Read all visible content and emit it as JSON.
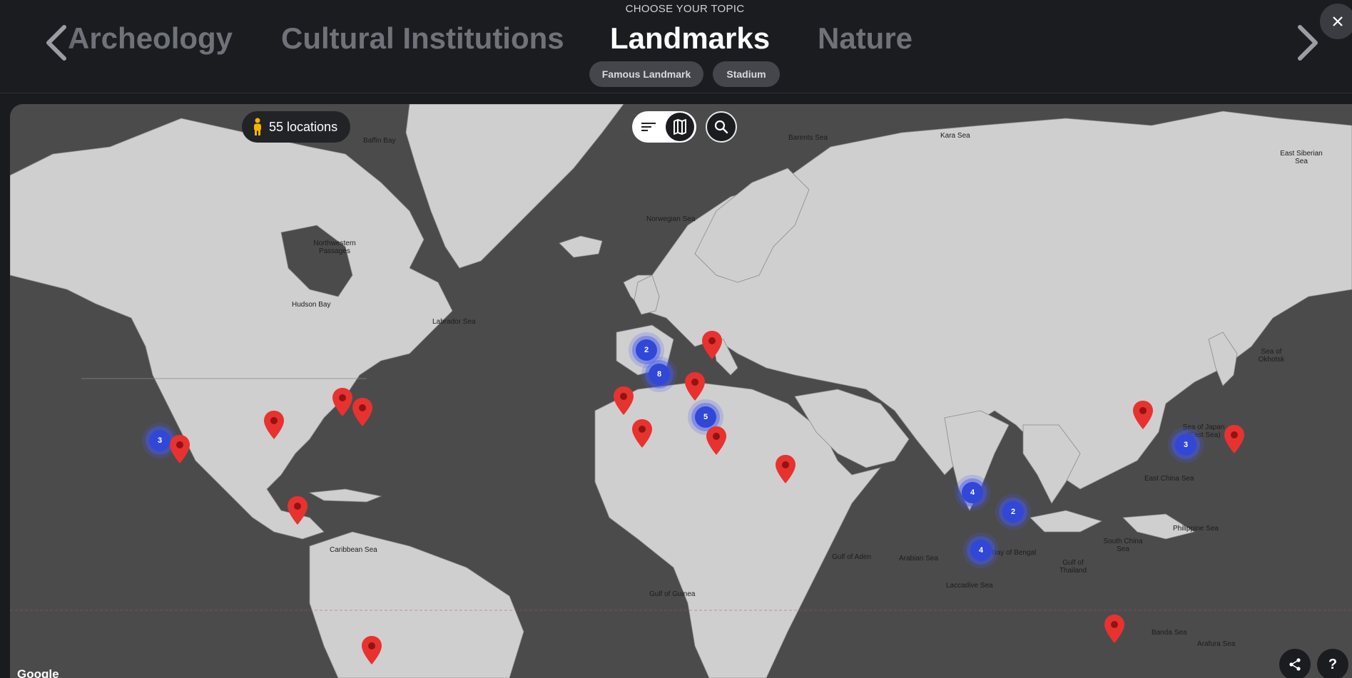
{
  "header": {
    "subtitle": "CHOOSE YOUR TOPIC",
    "topics": [
      {
        "label": "Archeology"
      },
      {
        "label": "Cultural Institutions"
      },
      {
        "label": "Landmarks"
      },
      {
        "label": "Nature"
      }
    ],
    "active_topic": "Landmarks",
    "chips": [
      {
        "label": "Famous Landmark"
      },
      {
        "label": "Stadium"
      }
    ]
  },
  "map": {
    "locations_label": "55 locations",
    "attribution": "Google",
    "help_label": "?",
    "sea_labels": [
      "Baffin Bay",
      "Barents Sea",
      "Kara Sea",
      "East Siberian Sea",
      "Norwegian Sea",
      "Northwestern Passages",
      "Hudson Bay",
      "Labrador Sea",
      "Sea of Okhotsk",
      "Sea of Japan (East Sea)",
      "East China Sea",
      "Philippine Sea",
      "South China Sea",
      "Caribbean Sea",
      "Gulf of Aden",
      "Arabian Sea",
      "Bay of Bengal",
      "Gulf of Thailand",
      "Laccadive Sea",
      "Gulf of Guinea",
      "Banda Sea",
      "Arafura Sea"
    ],
    "clusters": [
      {
        "count": "2"
      },
      {
        "count": "8"
      },
      {
        "count": "5"
      },
      {
        "count": "3"
      },
      {
        "count": "4"
      },
      {
        "count": "2"
      },
      {
        "count": "4"
      },
      {
        "count": "3"
      }
    ]
  },
  "colors": {
    "accent_cluster": "#3147d8",
    "pin": "#e8322f",
    "land": "#cfcfcf",
    "water": "#4b4b4c"
  },
  "icons": [
    "chevron-left-icon",
    "chevron-right-icon",
    "close-icon",
    "person-icon",
    "list-icon",
    "map-icon",
    "search-icon",
    "share-icon",
    "help-icon",
    "map-pin-icon"
  ]
}
